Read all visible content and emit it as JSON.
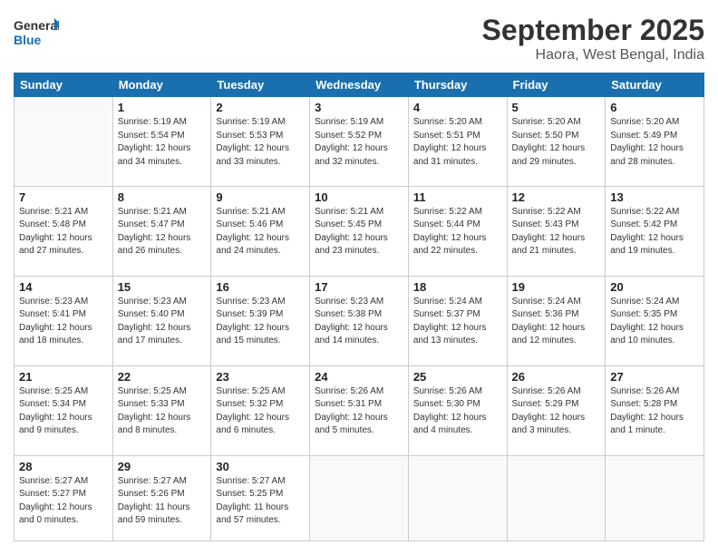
{
  "header": {
    "logo_line1": "General",
    "logo_line2": "Blue",
    "month": "September 2025",
    "location": "Haora, West Bengal, India"
  },
  "days_of_week": [
    "Sunday",
    "Monday",
    "Tuesday",
    "Wednesday",
    "Thursday",
    "Friday",
    "Saturday"
  ],
  "weeks": [
    [
      {
        "day": "",
        "info": ""
      },
      {
        "day": "1",
        "info": "Sunrise: 5:19 AM\nSunset: 5:54 PM\nDaylight: 12 hours\nand 34 minutes."
      },
      {
        "day": "2",
        "info": "Sunrise: 5:19 AM\nSunset: 5:53 PM\nDaylight: 12 hours\nand 33 minutes."
      },
      {
        "day": "3",
        "info": "Sunrise: 5:19 AM\nSunset: 5:52 PM\nDaylight: 12 hours\nand 32 minutes."
      },
      {
        "day": "4",
        "info": "Sunrise: 5:20 AM\nSunset: 5:51 PM\nDaylight: 12 hours\nand 31 minutes."
      },
      {
        "day": "5",
        "info": "Sunrise: 5:20 AM\nSunset: 5:50 PM\nDaylight: 12 hours\nand 29 minutes."
      },
      {
        "day": "6",
        "info": "Sunrise: 5:20 AM\nSunset: 5:49 PM\nDaylight: 12 hours\nand 28 minutes."
      }
    ],
    [
      {
        "day": "7",
        "info": "Sunrise: 5:21 AM\nSunset: 5:48 PM\nDaylight: 12 hours\nand 27 minutes."
      },
      {
        "day": "8",
        "info": "Sunrise: 5:21 AM\nSunset: 5:47 PM\nDaylight: 12 hours\nand 26 minutes."
      },
      {
        "day": "9",
        "info": "Sunrise: 5:21 AM\nSunset: 5:46 PM\nDaylight: 12 hours\nand 24 minutes."
      },
      {
        "day": "10",
        "info": "Sunrise: 5:21 AM\nSunset: 5:45 PM\nDaylight: 12 hours\nand 23 minutes."
      },
      {
        "day": "11",
        "info": "Sunrise: 5:22 AM\nSunset: 5:44 PM\nDaylight: 12 hours\nand 22 minutes."
      },
      {
        "day": "12",
        "info": "Sunrise: 5:22 AM\nSunset: 5:43 PM\nDaylight: 12 hours\nand 21 minutes."
      },
      {
        "day": "13",
        "info": "Sunrise: 5:22 AM\nSunset: 5:42 PM\nDaylight: 12 hours\nand 19 minutes."
      }
    ],
    [
      {
        "day": "14",
        "info": "Sunrise: 5:23 AM\nSunset: 5:41 PM\nDaylight: 12 hours\nand 18 minutes."
      },
      {
        "day": "15",
        "info": "Sunrise: 5:23 AM\nSunset: 5:40 PM\nDaylight: 12 hours\nand 17 minutes."
      },
      {
        "day": "16",
        "info": "Sunrise: 5:23 AM\nSunset: 5:39 PM\nDaylight: 12 hours\nand 15 minutes."
      },
      {
        "day": "17",
        "info": "Sunrise: 5:23 AM\nSunset: 5:38 PM\nDaylight: 12 hours\nand 14 minutes."
      },
      {
        "day": "18",
        "info": "Sunrise: 5:24 AM\nSunset: 5:37 PM\nDaylight: 12 hours\nand 13 minutes."
      },
      {
        "day": "19",
        "info": "Sunrise: 5:24 AM\nSunset: 5:36 PM\nDaylight: 12 hours\nand 12 minutes."
      },
      {
        "day": "20",
        "info": "Sunrise: 5:24 AM\nSunset: 5:35 PM\nDaylight: 12 hours\nand 10 minutes."
      }
    ],
    [
      {
        "day": "21",
        "info": "Sunrise: 5:25 AM\nSunset: 5:34 PM\nDaylight: 12 hours\nand 9 minutes."
      },
      {
        "day": "22",
        "info": "Sunrise: 5:25 AM\nSunset: 5:33 PM\nDaylight: 12 hours\nand 8 minutes."
      },
      {
        "day": "23",
        "info": "Sunrise: 5:25 AM\nSunset: 5:32 PM\nDaylight: 12 hours\nand 6 minutes."
      },
      {
        "day": "24",
        "info": "Sunrise: 5:26 AM\nSunset: 5:31 PM\nDaylight: 12 hours\nand 5 minutes."
      },
      {
        "day": "25",
        "info": "Sunrise: 5:26 AM\nSunset: 5:30 PM\nDaylight: 12 hours\nand 4 minutes."
      },
      {
        "day": "26",
        "info": "Sunrise: 5:26 AM\nSunset: 5:29 PM\nDaylight: 12 hours\nand 3 minutes."
      },
      {
        "day": "27",
        "info": "Sunrise: 5:26 AM\nSunset: 5:28 PM\nDaylight: 12 hours\nand 1 minute."
      }
    ],
    [
      {
        "day": "28",
        "info": "Sunrise: 5:27 AM\nSunset: 5:27 PM\nDaylight: 12 hours\nand 0 minutes."
      },
      {
        "day": "29",
        "info": "Sunrise: 5:27 AM\nSunset: 5:26 PM\nDaylight: 11 hours\nand 59 minutes."
      },
      {
        "day": "30",
        "info": "Sunrise: 5:27 AM\nSunset: 5:25 PM\nDaylight: 11 hours\nand 57 minutes."
      },
      {
        "day": "",
        "info": ""
      },
      {
        "day": "",
        "info": ""
      },
      {
        "day": "",
        "info": ""
      },
      {
        "day": "",
        "info": ""
      }
    ]
  ]
}
